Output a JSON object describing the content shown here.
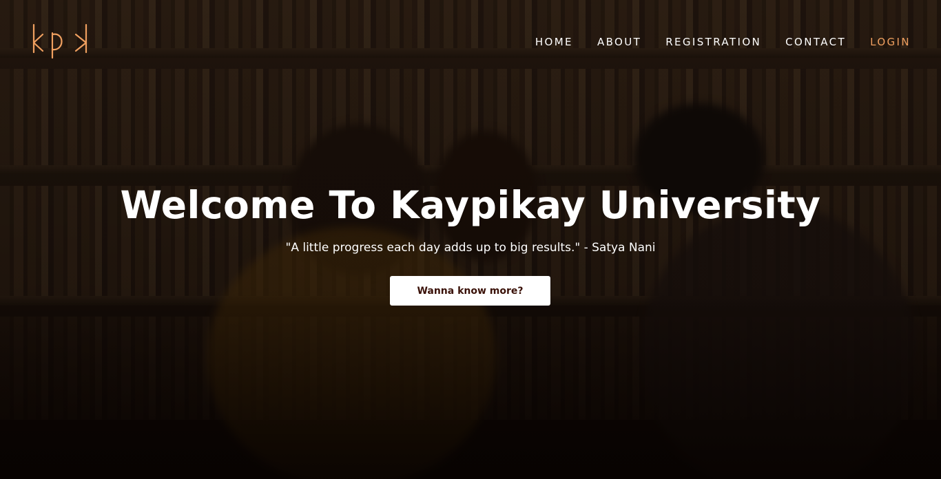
{
  "brand": {
    "logo_text": "kpk",
    "accent_color": "#f0a060"
  },
  "nav": {
    "items": [
      {
        "label": "HOME"
      },
      {
        "label": "ABOUT"
      },
      {
        "label": "REGISTRATION"
      },
      {
        "label": "CONTACT"
      },
      {
        "label": "LOGIN"
      }
    ]
  },
  "hero": {
    "title": "Welcome To Kaypikay University",
    "quote": "\"A little progress each day adds up to big results.\" - Satya Nani",
    "cta_label": "Wanna know more?",
    "background_image": "library-students-photo"
  },
  "colors": {
    "cta_text": "#3a1108",
    "cta_bg": "#ffffff",
    "text": "#ffffff"
  }
}
